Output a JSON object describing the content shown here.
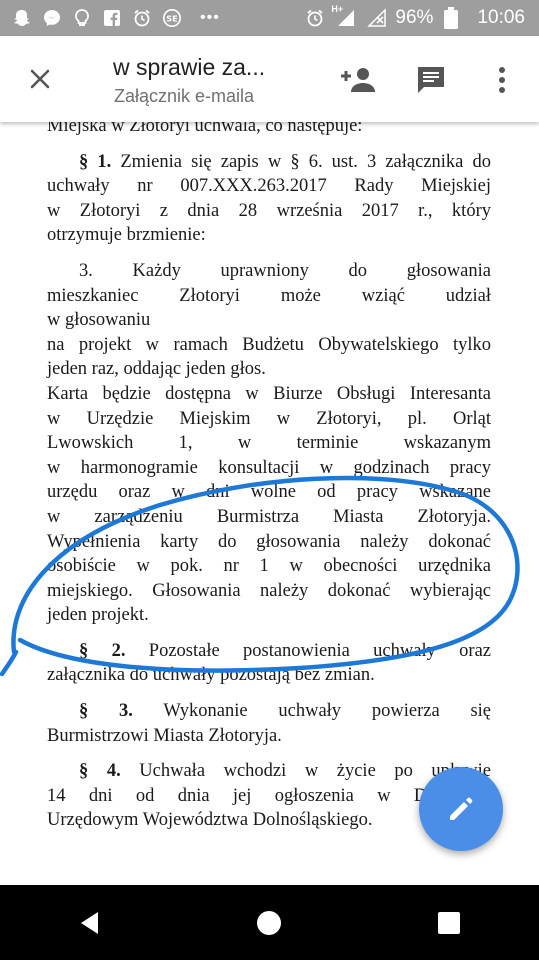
{
  "status_bar": {
    "battery": "96%",
    "time": "10:06",
    "network": "H+",
    "left_icons": [
      "snapchat-icon",
      "messenger-icon",
      "bulb-icon",
      "facebook-icon",
      "alarm-icon",
      "sf-icon",
      "more-dots"
    ],
    "right_icons": [
      "alarm-icon",
      "signal-icon",
      "no-signal-icon",
      "battery-icon"
    ]
  },
  "app_bar": {
    "title": "w sprawie za...",
    "subtitle": "Załącznik e-maila",
    "icons": [
      "close-icon",
      "add-person-icon",
      "comment-icon",
      "more-vert-icon"
    ]
  },
  "document": {
    "line0": "Miejska w Złotoryi uchwala, co następuje:",
    "s1_num": "§ 1.",
    "s1_l1": "Zmienia się zapis w § 6. ust. 3 załącznika do",
    "s1_l2": "uchwały nr 007.XXX.263.2017 Rady Miejskiej",
    "s1_l3": "w Złotoryi z dnia 28 września 2017 r., który",
    "s1_l4": "otrzymuje brzmienie:",
    "q_l1": "3. Każdy uprawniony do głosowania",
    "q_l2": "mieszkaniec Złotoryi może wziąć udział",
    "q_l3": "w głosowaniu",
    "q_l4": "na projekt w ramach Budżetu Obywatelskiego tylko",
    "q_l5": "jeden raz, oddając jeden głos.",
    "q_l6": "Karta będzie dostępna w Biurze Obsługi Interesanta",
    "q_l7": "w Urzędzie Miejskim w Złotoryi, pl. Orląt",
    "q_l8": "Lwowskich 1, w terminie wskazanym",
    "q_l9": "w harmonogramie konsultacji w godzinach pracy",
    "q_l10": "urzędu oraz w dni wolne od pracy wskazane",
    "q_l11": "w zarządzeniu Burmistrza Miasta Złotoryja.",
    "q_l12": "Wypełnienia karty do głosowania należy dokonać",
    "q_l13": "osobiście w pok. nr 1 w obecności urzędnika",
    "q_l14": "miejskiego. Głosowania należy dokonać wybierając",
    "q_l15": "jeden projekt.",
    "s2_num": "§ 2.",
    "s2_l1": "Pozostałe postanowienia uchwały oraz",
    "s2_l2": "załącznika do uchwały pozostają bez zmian.",
    "s3_num": "§ 3.",
    "s3_l1": "Wykonanie uchwały powierza się",
    "s3_l2": "Burmistrzowi Miasta Złotoryja.",
    "s4_num": "§ 4.",
    "s4_l1": "Uchwała wchodzi w życie po upływie",
    "s4_l2": "14 dni od dnia jej ogłoszenia w Dzienniku",
    "s4_l3": "Urzędowym Województwa Dolnośląskiego."
  },
  "annotation": {
    "color": "#1e78d6",
    "shape": "hand-drawn-ellipse"
  },
  "fab": {
    "icon": "edit-pencil-icon",
    "color": "#4a8ee8"
  },
  "nav_bar": {
    "buttons": [
      "back-icon",
      "home-icon",
      "recents-icon"
    ]
  }
}
